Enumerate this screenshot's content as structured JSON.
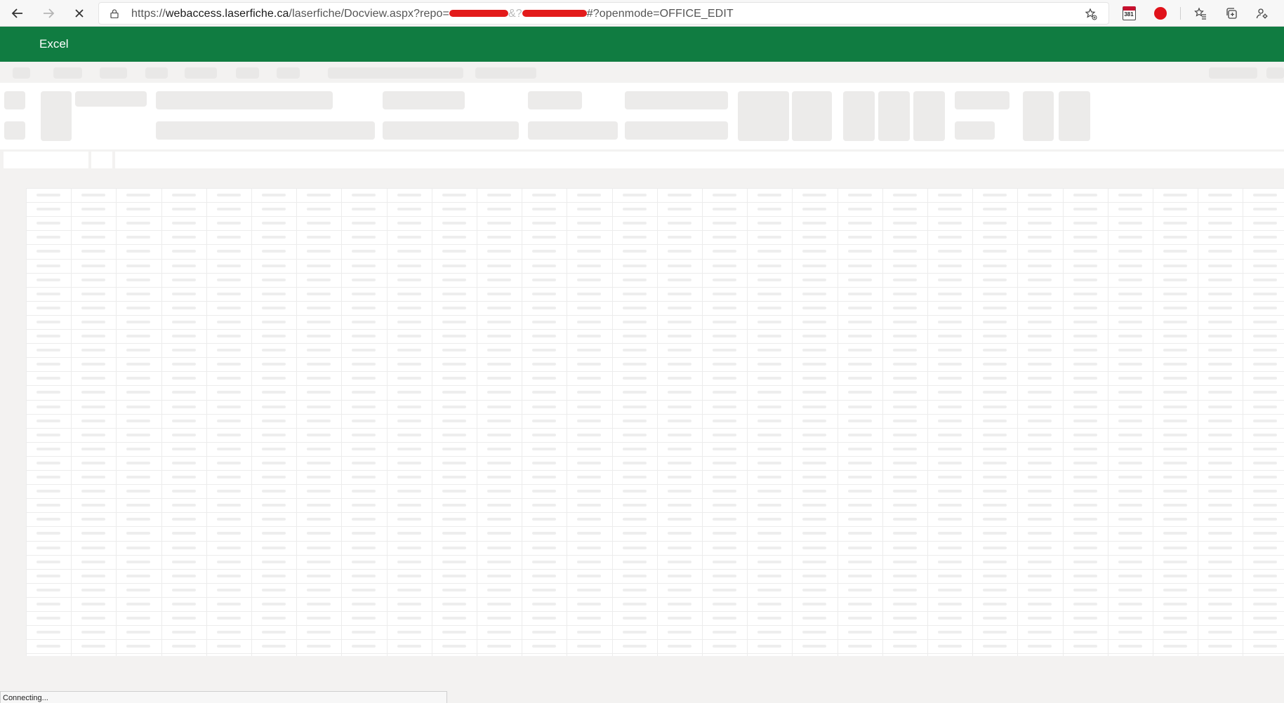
{
  "browser": {
    "url_prefix": "https://",
    "url_host": "webaccess.laserfiche.ca",
    "url_path": "/laserfiche/Docview.aspx?repo=",
    "url_mid": "&?",
    "url_suffix": "#?openmode=OFFICE_EDIT",
    "back_icon": "arrow-left-icon",
    "forward_icon": "arrow-right-icon",
    "stop_icon": "close-icon",
    "calendar_badge": "381"
  },
  "app": {
    "title": "Excel",
    "header_color": "#107c41"
  },
  "status": {
    "text": "Connecting..."
  }
}
